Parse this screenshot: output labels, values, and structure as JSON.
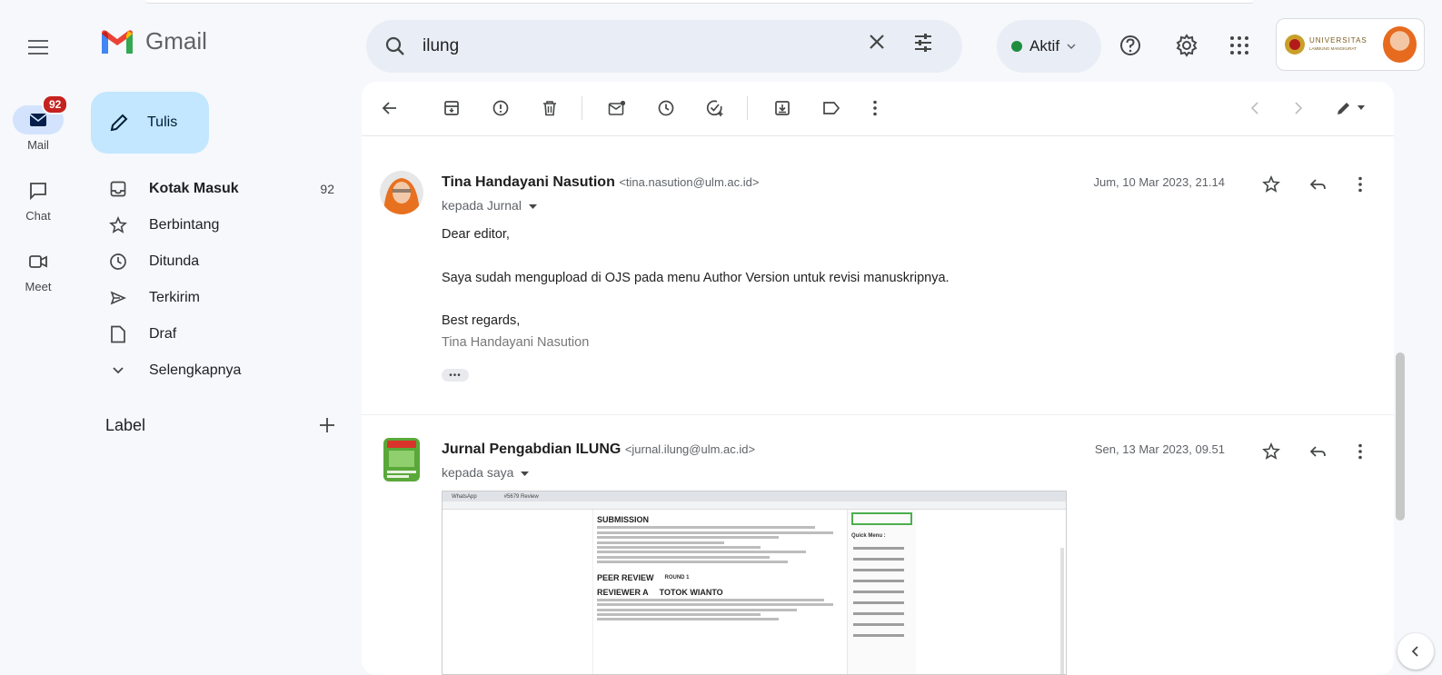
{
  "app": {
    "name": "Gmail"
  },
  "search": {
    "query": "ilung"
  },
  "status": {
    "label": "Aktif",
    "color": "#1e8e3e"
  },
  "account": {
    "org_name": "UNIVERSITAS",
    "org_sub": "LAMBUNG MANGKURAT"
  },
  "rail": [
    {
      "label": "Mail",
      "icon": "mail-icon",
      "badge": "92",
      "active": true
    },
    {
      "label": "Chat",
      "icon": "chat-icon"
    },
    {
      "label": "Meet",
      "icon": "video-icon"
    }
  ],
  "compose": {
    "label": "Tulis"
  },
  "nav": [
    {
      "label": "Kotak Masuk",
      "count": "92",
      "icon": "inbox-icon",
      "bold": true
    },
    {
      "label": "Berbintang",
      "icon": "star-icon"
    },
    {
      "label": "Ditunda",
      "icon": "clock-icon"
    },
    {
      "label": "Terkirim",
      "icon": "send-icon"
    },
    {
      "label": "Draf",
      "icon": "draft-icon"
    },
    {
      "label": "Selengkapnya",
      "icon": "chevron-down-icon"
    }
  ],
  "labels": {
    "heading": "Label"
  },
  "messages": [
    {
      "sender_name": "Tina Handayani Nasution",
      "sender_email": "<tina.nasution@ulm.ac.id>",
      "to": "kepada Jurnal",
      "date": "Jum, 10 Mar 2023, 21.14",
      "body": [
        "Dear editor,",
        "Saya sudah mengupload di OJS pada menu Author Version untuk revisi manuskripnya.",
        "Best regards,",
        "Tina Handayani Nasution"
      ]
    },
    {
      "sender_name": "Jurnal Pengabdian ILUNG",
      "sender_email": "<jurnal.ilung@ulm.ac.id>",
      "to": "kepada saya",
      "date": "Sen, 13 Mar 2023, 09.51",
      "attachment": {
        "tabs": [
          "WhatsApp",
          "#5679 Review"
        ],
        "h_submission": "SUBMISSION",
        "h_peer": "PEER REVIEW",
        "round": "ROUND 1",
        "h_reviewer": "REVIEWER A",
        "reviewer_name": "TOTOK WIANTO",
        "side_title": "Quick Menu :"
      }
    }
  ]
}
